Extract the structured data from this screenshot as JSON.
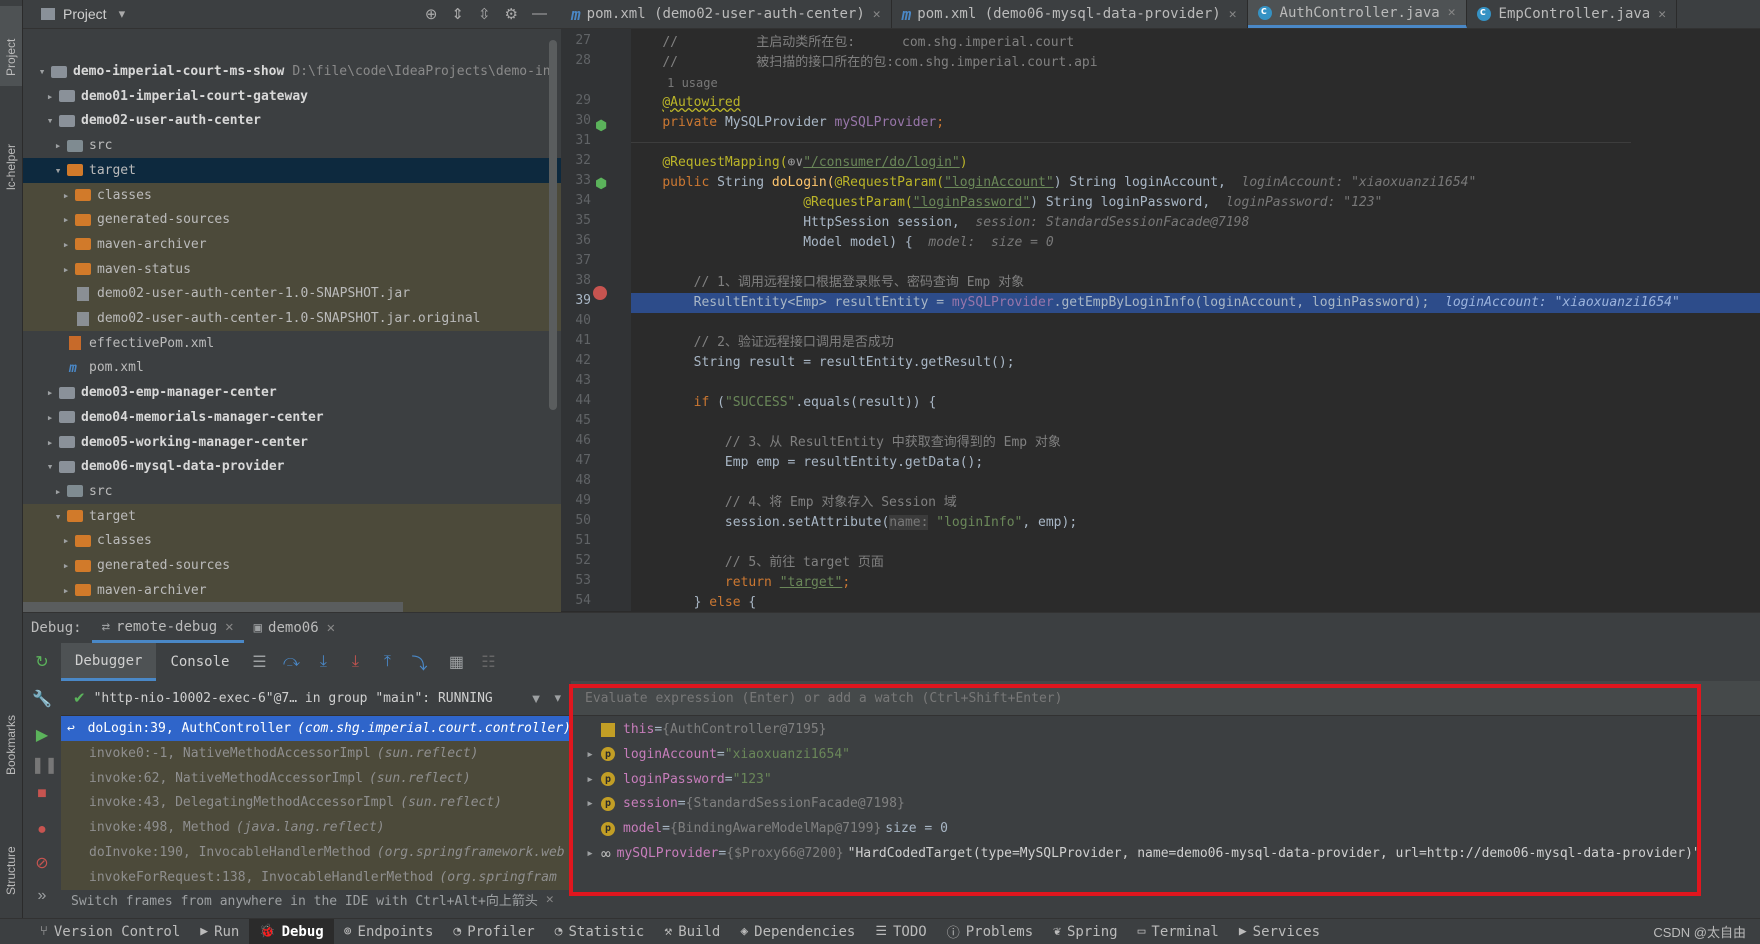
{
  "left_strip": {
    "project": "Project",
    "lc_helper": "lc-helper",
    "bookmarks": "Bookmarks",
    "structure": "Structure"
  },
  "project": {
    "title": "Project",
    "rows": [
      {
        "label": "demo-imperial-court-ms-show",
        "extra": "D:\\file\\code\\IdeaProjects\\demo-in"
      },
      {
        "label": "demo01-imperial-court-gateway"
      },
      {
        "label": "demo02-user-auth-center"
      },
      {
        "label": "src"
      },
      {
        "label": "target"
      },
      {
        "label": "classes"
      },
      {
        "label": "generated-sources"
      },
      {
        "label": "maven-archiver"
      },
      {
        "label": "maven-status"
      },
      {
        "label": "demo02-user-auth-center-1.0-SNAPSHOT.jar"
      },
      {
        "label": "demo02-user-auth-center-1.0-SNAPSHOT.jar.original"
      },
      {
        "label": "effectivePom.xml"
      },
      {
        "label": "pom.xml"
      },
      {
        "label": "demo03-emp-manager-center"
      },
      {
        "label": "demo04-memorials-manager-center"
      },
      {
        "label": "demo05-working-manager-center"
      },
      {
        "label": "demo06-mysql-data-provider"
      },
      {
        "label": "src"
      },
      {
        "label": "target"
      },
      {
        "label": "classes"
      },
      {
        "label": "generated-sources"
      },
      {
        "label": "maven-archiver"
      },
      {
        "label": "maven-status"
      }
    ]
  },
  "tabs": [
    {
      "label": "pom.xml (demo02-user-auth-center)"
    },
    {
      "label": "pom.xml (demo06-mysql-data-provider)"
    },
    {
      "label": "AuthController.java"
    },
    {
      "label": "EmpController.java"
    }
  ],
  "editor": {
    "line_numbers": [
      "27",
      "28",
      "",
      "29",
      "30",
      "31",
      "32",
      "33",
      "34",
      "35",
      "36",
      "37",
      "38",
      "39",
      "40",
      "41",
      "42",
      "43",
      "44",
      "45",
      "46",
      "47",
      "48",
      "49",
      "50",
      "51",
      "52",
      "53",
      "54"
    ],
    "l27_cmt": "//          主启动类所在包:      com.shg.imperial.court",
    "l28_cmt": "//          被扫描的接口所在的包:com.shg.imperial.court.api",
    "usage": "1 usage",
    "l29_ann": "@Autowired",
    "l30_kw": "private ",
    "l30_type": "MySQLProvider ",
    "l30_fld": "mySQLProvider",
    "l30_end": ";",
    "l32_ann": "@RequestMapping(",
    "l32_glyph": "⊕∨",
    "l32_str": "\"/consumer/do/login\"",
    "l32_end": ")",
    "l33_kw": "public ",
    "l33_a": "String ",
    "l33_m": "doLogin(",
    "l33_ann": "@RequestParam(",
    "l33_str": "\"loginAccount\"",
    "l33_b": ") String loginAccount,",
    "l33_hint": "loginAccount: \"xiaoxuanzi1654\"",
    "l34_ann": "@RequestParam(",
    "l34_str": "\"loginPassword\"",
    "l34_b": ") String loginPassword,",
    "l34_hint": "loginPassword: \"123\"",
    "l35_a": "HttpSession session,",
    "l35_hint": "session: StandardSessionFacade@7198",
    "l36_a": "Model model) {",
    "l36_hint": "model:  size = 0",
    "l38_cmt": "// 1、调用远程接口根据登录账号、密码查询 Emp 对象",
    "l39_a": "ResultEntity<Emp> resultEntity = ",
    "l39_fld": "mySQLProvider",
    "l39_b": ".getEmpByLoginInfo(loginAccount, loginPassword);",
    "l39_hint": "loginAccount: \"xiaoxuanzi1654\"",
    "l41_cmt": "// 2、验证远程接口调用是否成功",
    "l42_a": "String result = resultEntity.getResult();",
    "l44_kw": "if ",
    "l44_a": "(",
    "l44_str": "\"SUCCESS\"",
    "l44_b": ".equals(result)) {",
    "l46_cmt": "// 3、从 ResultEntity 中获取查询得到的 Emp 对象",
    "l47_a": "Emp emp = resultEntity.getData();",
    "l49_cmt": "// 4、将 Emp 对象存入 Session 域",
    "l50_a": "session.setAttribute(",
    "l50_hint": "name:",
    "l50_str": "\"loginInfo\"",
    "l50_b": ", emp);",
    "l52_cmt": "// 5、前往 target 页面",
    "l53_kw": "return ",
    "l53_str": "\"target\"",
    "l53_end": ";",
    "l54_a": "} ",
    "l54_kw": "else",
    "l54_b": " {"
  },
  "debug": {
    "label": "Debug:",
    "tabs": [
      {
        "label": "remote-debug"
      },
      {
        "label": "demo06"
      }
    ],
    "debugger": "Debugger",
    "console": "Console",
    "thread": "\"http-nio-10002-exec-6\"@7… in group \"main\": RUNNING",
    "frames": [
      {
        "method": "doLogin:39, AuthController",
        "pkg": "(com.shg.imperial.court.controller)"
      },
      {
        "method": "invoke0:-1, NativeMethodAccessorImpl",
        "pkg": "(sun.reflect)"
      },
      {
        "method": "invoke:62, NativeMethodAccessorImpl",
        "pkg": "(sun.reflect)"
      },
      {
        "method": "invoke:43, DelegatingMethodAccessorImpl",
        "pkg": "(sun.reflect)"
      },
      {
        "method": "invoke:498, Method",
        "pkg": "(java.lang.reflect)"
      },
      {
        "method": "doInvoke:190, InvocableHandlerMethod",
        "pkg": "(org.springframework.web"
      },
      {
        "method": "invokeForRequest:138, InvocableHandlerMethod",
        "pkg": "(org.springfram"
      }
    ],
    "switch_hint": "Switch frames from anywhere in the IDE with Ctrl+Alt+向上箭头",
    "eval_placeholder": "Evaluate expression (Enter) or add a watch (Ctrl+Shift+Enter)",
    "vars": [
      {
        "name": "this",
        "value": "{AuthController@7195}"
      },
      {
        "name": "loginAccount",
        "value": "\"xiaoxuanzi1654\""
      },
      {
        "name": "loginPassword",
        "value": "\"123\""
      },
      {
        "name": "session",
        "value": "{StandardSessionFacade@7198}"
      },
      {
        "name": "model",
        "value": "{BindingAwareModelMap@7199}",
        "extra": " size = 0"
      },
      {
        "name": "mySQLProvider",
        "value": "{$Proxy66@7200}",
        "extra": " \"HardCodedTarget(type=MySQLProvider, name=demo06-mysql-data-provider, url=http://demo06-mysql-data-provider)\""
      }
    ]
  },
  "statusbar": {
    "items": [
      "Version Control",
      "Run",
      "Debug",
      "Endpoints",
      "Profiler",
      "Statistic",
      "Build",
      "Dependencies",
      "TODO",
      "Problems",
      "Spring",
      "Terminal",
      "Services"
    ],
    "watermark": "CSDN @太自由"
  },
  "colors": {
    "accent": "#4a88c7",
    "highlight": "#2d4c8a",
    "redbox": "#e0161e"
  }
}
